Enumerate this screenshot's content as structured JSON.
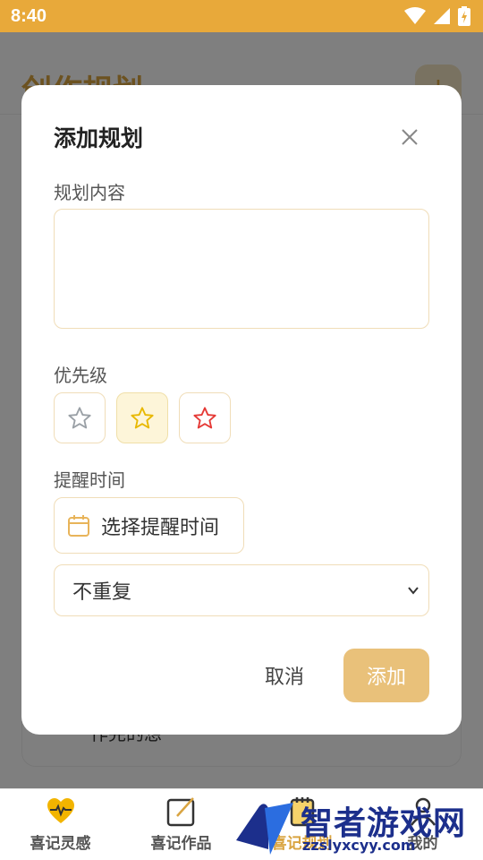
{
  "status_bar": {
    "time": "8:40"
  },
  "background_page": {
    "title": "创作规划",
    "add_button_label": "+",
    "card_text": "作完的想"
  },
  "dialog": {
    "title": "添加规划",
    "content_label": "规划内容",
    "content_value": "",
    "priority_label": "优先级",
    "priority_options": [
      {
        "name": "low",
        "color": "#9aa0a6",
        "selected": false
      },
      {
        "name": "medium",
        "color": "#e8b800",
        "selected": true
      },
      {
        "name": "high",
        "color": "#e53935",
        "selected": false
      }
    ],
    "reminder_label": "提醒时间",
    "reminder_button_label": "选择提醒时间",
    "repeat_selected": "不重复",
    "cancel_label": "取消",
    "add_label": "添加"
  },
  "bottom_nav": {
    "items": [
      {
        "label": "喜记灵感",
        "icon": "heart-pulse-icon"
      },
      {
        "label": "喜记作品",
        "icon": "edit-icon"
      },
      {
        "label": "喜记规划",
        "icon": "notepad-icon",
        "active": true
      },
      {
        "label": "我的",
        "icon": "user-icon"
      }
    ]
  },
  "watermark": {
    "text": "智者游戏网",
    "url": "zzslyxcyy.com"
  },
  "colors": {
    "accent": "#e8a93a",
    "add_button": "#e9c17a",
    "input_border": "#f0ddb8"
  }
}
